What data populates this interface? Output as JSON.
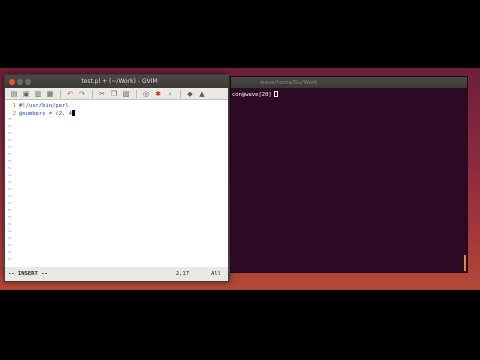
{
  "gvim": {
    "title": "test.pl + (~/Work) - GVIM",
    "lines": [
      {
        "num": "1",
        "text": "#!/usr/bin/perl"
      },
      {
        "num": "2",
        "text": "@numbers = (2, 4"
      }
    ],
    "status_mode": "-- INSERT --",
    "status_pos": "2,17",
    "status_pct": "All"
  },
  "terminal": {
    "title": "wave/home/Gu/Work",
    "prompt": "con@wave[20]"
  }
}
